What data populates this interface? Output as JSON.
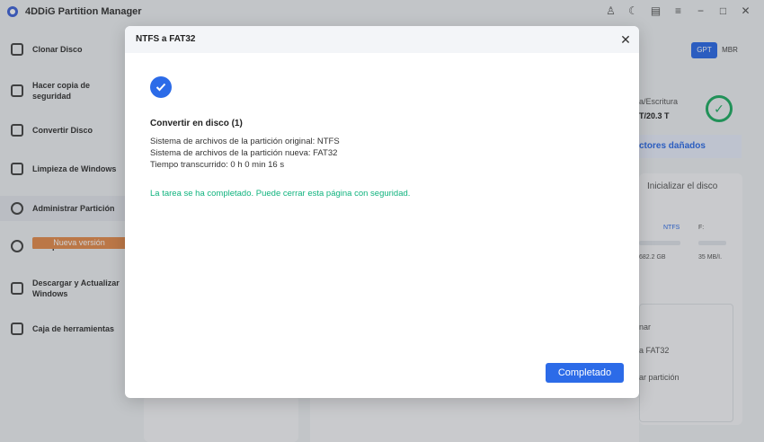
{
  "app": {
    "title": "4DDiG Partition Manager"
  },
  "window_controls": {
    "icons": [
      "user-icon",
      "theme-icon",
      "feedback-icon",
      "menu-icon",
      "minimize-icon",
      "maximize-icon",
      "close-icon"
    ],
    "glyphs": [
      "♙",
      "☾",
      "▤",
      "≡",
      "−",
      "□",
      "✕"
    ]
  },
  "sidebar": {
    "items": [
      {
        "label": "Clonar Disco"
      },
      {
        "label": "Hacer copia de seguridad"
      },
      {
        "label": "Convertir Disco"
      },
      {
        "label": "Limpieza de Windows"
      },
      {
        "label": "Administrar Partición"
      },
      {
        "label": "Recuperar Partición"
      },
      {
        "label": "Descargar y Actualizar Windows"
      },
      {
        "label": "Caja de herramientas"
      }
    ],
    "new_badge": "Nueva versión"
  },
  "background": {
    "gpt": "GPT",
    "mbr": "MBR",
    "read_write": "a/Escritura",
    "capacity": "T/20.3 T",
    "bad_sectors": "ctores dañados",
    "init_disk": "Inicializar el disco",
    "ntfs": "NTFS",
    "drive_f": "F:",
    "size_a": "682.2 GB",
    "size_b": "35 MB/I.",
    "action_1": "nar",
    "action_2": "a FAT32",
    "action_3": "ar partición",
    "colors": {
      "accent": "#2c6be8",
      "success": "#10b37e",
      "badge": "#e48c4e"
    }
  },
  "dialog": {
    "title": "NTFS a FAT32",
    "task_title": "Convertir en disco (1)",
    "lines": [
      "Sistema de archivos de la partición original: NTFS",
      "Sistema de archivos de la partición nueva: FAT32",
      "Tiempo transcurrido: 0 h 0 min 16 s"
    ],
    "success_message": "La tarea se ha completado. Puede cerrar esta página con seguridad.",
    "button_label": "Completado"
  }
}
